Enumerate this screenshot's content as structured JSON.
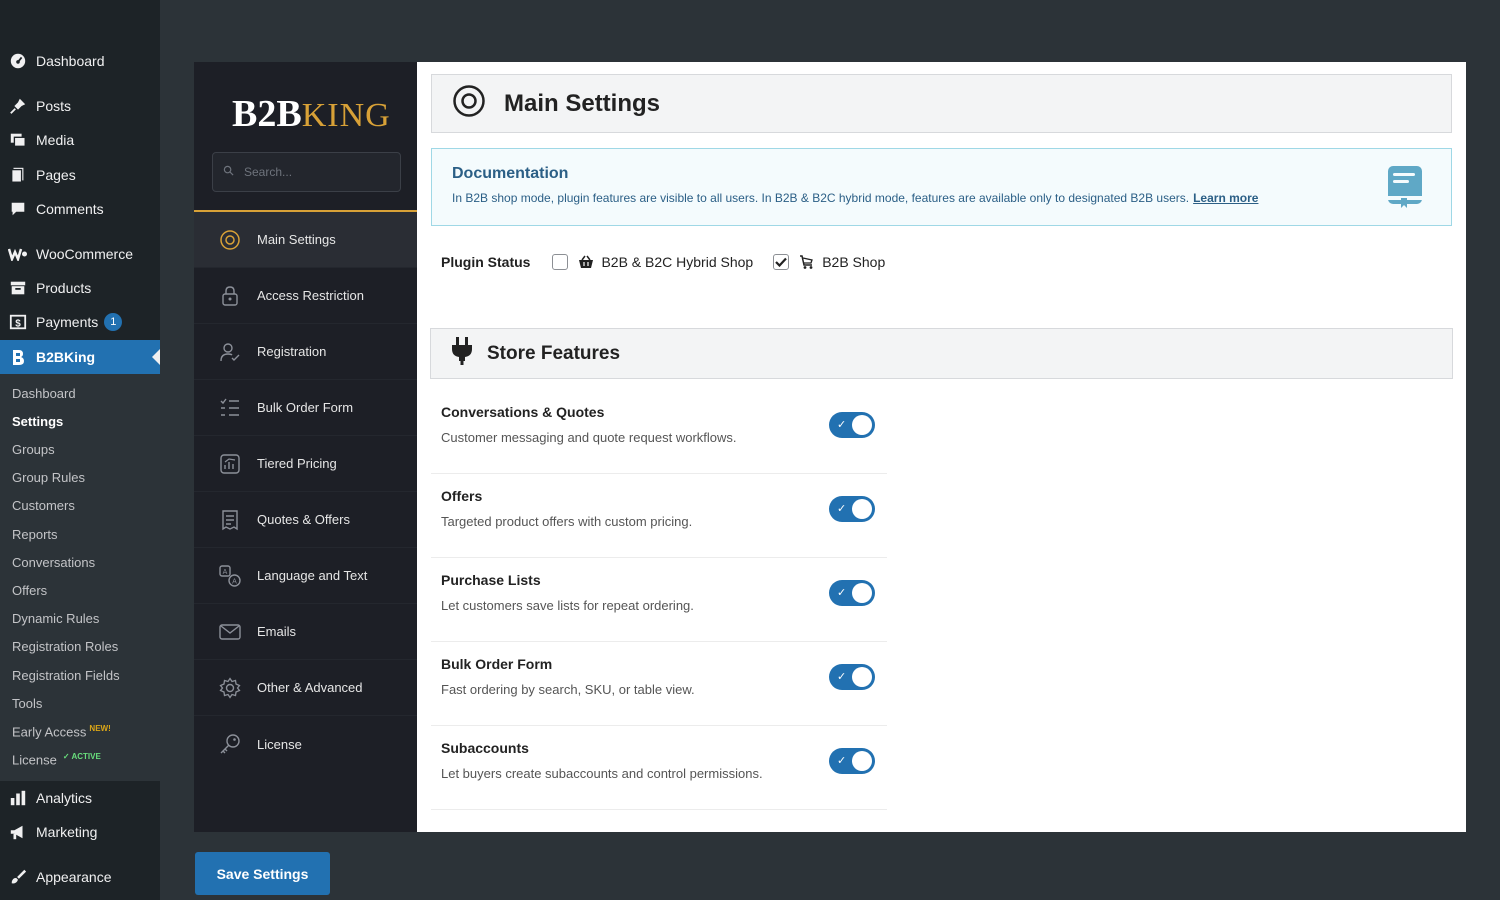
{
  "wp_menu": {
    "dashboard": "Dashboard",
    "posts": "Posts",
    "media": "Media",
    "pages": "Pages",
    "comments": "Comments",
    "woocommerce": "WooCommerce",
    "products": "Products",
    "payments": "Payments",
    "payments_badge": "1",
    "b2bking": "B2BKing",
    "analytics": "Analytics",
    "marketing": "Marketing",
    "appearance": "Appearance"
  },
  "b2bking_submenu": {
    "dashboard": "Dashboard",
    "settings": "Settings",
    "groups": "Groups",
    "group_rules": "Group Rules",
    "customers": "Customers",
    "reports": "Reports",
    "conversations": "Conversations",
    "offers": "Offers",
    "dynamic_rules": "Dynamic Rules",
    "registration_roles": "Registration Roles",
    "registration_fields": "Registration Fields",
    "tools": "Tools",
    "early_access": "Early Access",
    "early_access_tag": "NEW!",
    "license": "License",
    "license_tag": "✓ ACTIVE"
  },
  "plugin_nav": {
    "logo_b2b": "B2B",
    "logo_king": "KING",
    "search_placeholder": "Search...",
    "items": {
      "main_settings": "Main Settings",
      "access_restriction": "Access Restriction",
      "registration": "Registration",
      "bulk_order_form": "Bulk Order Form",
      "tiered_pricing": "Tiered Pricing",
      "quotes_offers": "Quotes & Offers",
      "language_text": "Language and Text",
      "emails": "Emails",
      "other_advanced": "Other & Advanced",
      "license": "License"
    }
  },
  "main": {
    "title": "Main Settings",
    "documentation": {
      "title": "Documentation",
      "text": "In B2B shop mode, plugin features are visible to all users. In B2B & B2C hybrid mode, features are available only to designated B2B users.",
      "link": "Learn more"
    },
    "plugin_status": {
      "label": "Plugin Status",
      "hybrid_label": "B2B & B2C Hybrid Shop",
      "hybrid_checked": false,
      "b2b_label": "B2B Shop",
      "b2b_checked": true
    },
    "store_features": {
      "title": "Store Features",
      "conversations": {
        "title": "Conversations & Quotes",
        "desc": "Customer messaging and quote request workflows.",
        "enabled": true
      },
      "offers": {
        "title": "Offers",
        "desc": "Targeted product offers with custom pricing.",
        "enabled": true
      },
      "purchase_lists": {
        "title": "Purchase Lists",
        "desc": "Let customers save lists for repeat ordering.",
        "enabled": true
      },
      "bulk_order": {
        "title": "Bulk Order Form",
        "desc": "Fast ordering by search, SKU, or table view.",
        "enabled": true
      },
      "subaccounts": {
        "title": "Subaccounts",
        "desc": "Let buyers create subaccounts and control permissions.",
        "enabled": true
      }
    }
  },
  "save_button": "Save Settings",
  "colors": {
    "wp_sidebar": "#1d2327",
    "wp_accent": "#2271b1",
    "plugin_nav_bg": "#1d1f26",
    "gold": "#d8a137"
  }
}
